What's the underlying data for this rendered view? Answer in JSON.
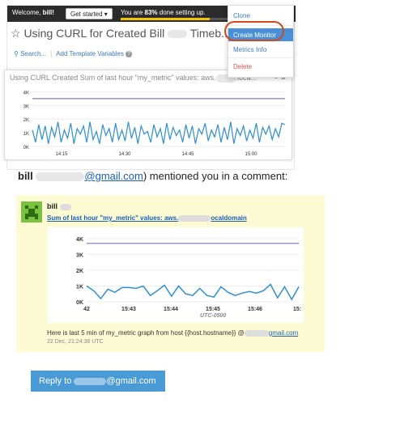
{
  "dashboard": {
    "welcome_prefix": "Welcome, ",
    "welcome_user": "bill!",
    "get_started_label": "Get started ▾",
    "progress_prefix": "You are ",
    "progress_percent_text": "83%",
    "progress_suffix": " done setting up.",
    "progress_fraction": 0.83,
    "title_prefix": "☆ Using CURL for Created Bill",
    "title_suffix": "Timeb...",
    "search_label": "Search...",
    "add_template_label": "Add Template Variables",
    "help_icon": "?"
  },
  "menu": {
    "items": [
      "Clone",
      "Create Monitor",
      "Metrics Info",
      "Delete"
    ],
    "active": "Create Monitor",
    "highlight_color": "#d04a1c"
  },
  "widget": {
    "title_prefix": "Using CURL Created Sum of last hour \"my_metric\" values: aws.",
    "title_suffix": ".loca...",
    "tools": "✎ ⚙"
  },
  "mention": {
    "name": "bill",
    "email_suffix": "@gmail.com",
    "tail": ") mentioned you in a comment:"
  },
  "card": {
    "author": "bill",
    "link_prefix": "Sum of last hour \"my_metric\" values: aws.",
    "link_suffix": "ocaldomain",
    "timezone": "UTC-0500",
    "message_prefix": "Here is last 5 min of my_metric graph from host {{host.hostname}} @",
    "message_email_suffix": "gmail.com",
    "timestamp": "22 Dec, 21:24:38 UTC"
  },
  "reply": {
    "prefix": "Reply to",
    "suffix": "@gmail.com"
  },
  "colors": {
    "line": "#2e8fcf",
    "threshold": "#8b79c9",
    "card_bg": "#fdfbd3",
    "avatar": "#7cc242"
  },
  "chart_data": [
    {
      "type": "line",
      "x_ticks": [
        "14:15",
        "14:30",
        "14:45",
        "15:00"
      ],
      "y_ticks": [
        "0K",
        "1K",
        "2K",
        "3K",
        "4K"
      ],
      "ylim": [
        0,
        4500
      ],
      "threshold": 3500,
      "series": [
        {
          "values": [
            1200,
            300,
            1600,
            500,
            1500,
            200,
            1400,
            700,
            1800,
            300,
            1200,
            600,
            1700,
            200,
            1300,
            900,
            1500,
            300,
            1800,
            500,
            1100,
            200,
            1600,
            800,
            1300,
            300,
            1700,
            500,
            1200,
            400,
            1800,
            600,
            1400,
            200,
            1500,
            900,
            1100,
            300,
            1600,
            700,
            1300,
            200,
            1700,
            500,
            1400,
            800,
            1200,
            300,
            1600,
            600,
            1500,
            200,
            1300,
            900,
            1700,
            400,
            1200,
            700,
            1600,
            300,
            1400,
            500,
            1800,
            200,
            1300,
            800,
            1500,
            400,
            1200,
            600,
            1700,
            300,
            1400,
            900,
            1500,
            500,
            1300,
            700,
            1700,
            1600
          ]
        }
      ]
    },
    {
      "type": "line",
      "x_ticks": [
        "42",
        "15:43",
        "15:44",
        "15:45",
        "15:46",
        "15:"
      ],
      "y_ticks": [
        "0K",
        "1K",
        "2K",
        "3K",
        "4K"
      ],
      "ylim": [
        0,
        4300
      ],
      "threshold": 3700,
      "series": [
        {
          "values": [
            1000,
            700,
            200,
            800,
            600,
            900,
            900,
            850,
            1000,
            400,
            700,
            1050,
            350,
            1000,
            500,
            400,
            850,
            400,
            300,
            950,
            600,
            400,
            550,
            650,
            550,
            700,
            1100,
            250,
            950,
            150,
            950
          ]
        }
      ]
    }
  ]
}
